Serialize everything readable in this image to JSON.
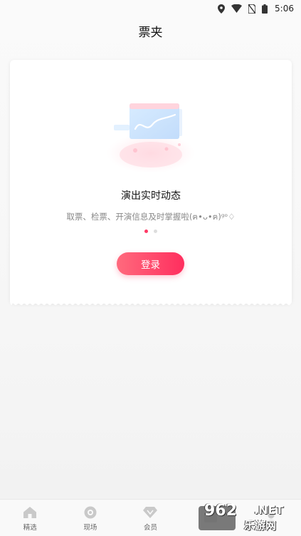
{
  "status_bar": {
    "time": "5:06",
    "icons": [
      "location-icon",
      "wifi-icon",
      "no-sim-icon",
      "battery-icon"
    ]
  },
  "header": {
    "title": "票夹"
  },
  "card": {
    "slide_title": "演出实时动态",
    "slide_description": "取票、检票、开演信息及时掌握啦(ฅ•ᴗ•ฅ)ᵍᵒ♢",
    "pager": {
      "total": 2,
      "active_index": 0
    },
    "login_label": "登录"
  },
  "tabs": [
    {
      "label": "精选",
      "icon": "home-icon"
    },
    {
      "label": "现场",
      "icon": "eye-icon"
    },
    {
      "label": "会员",
      "icon": "diamond-icon"
    },
    {
      "label": "",
      "icon": "tickets-icon"
    },
    {
      "label": "",
      "icon": "profile-icon"
    }
  ],
  "watermark": {
    "number": "962",
    "domain": ".NET",
    "sub": "乐游网"
  },
  "colors": {
    "accent": "#ff3a66",
    "accent_light": "#ff6a7d"
  }
}
